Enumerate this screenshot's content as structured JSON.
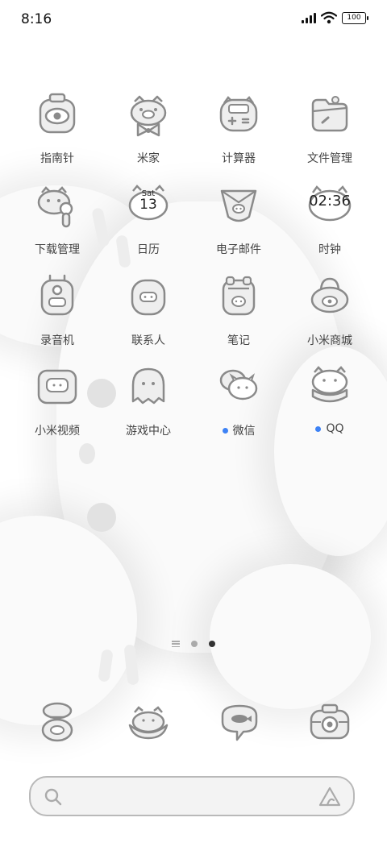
{
  "status": {
    "time": "8:16",
    "battery": "100",
    "icons": [
      "signal-icon",
      "wifi-icon",
      "battery-icon"
    ]
  },
  "apps": [
    {
      "label": "指南针",
      "icon": "compass-icon"
    },
    {
      "label": "米家",
      "icon": "mijia-icon"
    },
    {
      "label": "计算器",
      "icon": "calculator-icon"
    },
    {
      "label": "文件管理",
      "icon": "file-manager-icon"
    },
    {
      "label": "下载管理",
      "icon": "download-manager-icon"
    },
    {
      "label": "日历",
      "icon": "calendar-icon",
      "icon_day": "Sat",
      "icon_date": "13"
    },
    {
      "label": "电子邮件",
      "icon": "email-icon"
    },
    {
      "label": "时钟",
      "icon": "clock-icon",
      "icon_time": "02:36"
    },
    {
      "label": "录音机",
      "icon": "recorder-icon"
    },
    {
      "label": "联系人",
      "icon": "contacts-icon"
    },
    {
      "label": "笔记",
      "icon": "notes-icon"
    },
    {
      "label": "小米商城",
      "icon": "mi-store-icon"
    },
    {
      "label": "小米视频",
      "icon": "mi-video-icon"
    },
    {
      "label": "游戏中心",
      "icon": "game-center-icon"
    },
    {
      "label": "微信",
      "icon": "wechat-icon",
      "new": true
    },
    {
      "label": "QQ",
      "icon": "qq-icon",
      "new": true
    }
  ],
  "pager": {
    "pages": 2,
    "current": 2
  },
  "dock": [
    {
      "icon": "phone-icon"
    },
    {
      "icon": "messages-icon"
    },
    {
      "icon": "browser-icon"
    },
    {
      "icon": "camera-icon"
    }
  ],
  "search": {
    "placeholder": "",
    "icons": [
      "search-icon",
      "assistant-icon"
    ]
  },
  "colors": {
    "notification": "#3d82f5",
    "icon_stroke": "#8a8a8a",
    "icon_fill": "#eeeeee"
  }
}
